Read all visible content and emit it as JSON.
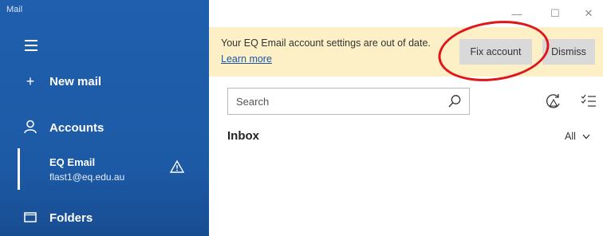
{
  "app": {
    "title": "Mail"
  },
  "sidebar": {
    "new_mail_label": "New mail",
    "accounts_label": "Accounts",
    "account": {
      "name": "EQ Email",
      "email": "flast1@eq.edu.au"
    },
    "folders_label": "Folders"
  },
  "window_controls": {
    "minimize": "—",
    "maximize": "☐",
    "close": "✕"
  },
  "banner": {
    "message": "Your EQ Email account settings are out of date.",
    "learn_more": "Learn more",
    "fix_account": "Fix account",
    "dismiss": "Dismiss"
  },
  "search": {
    "placeholder": "Search"
  },
  "inbox": {
    "title": "Inbox",
    "filter": "All"
  },
  "colors": {
    "sidebar": "#1f5fad",
    "banner": "#fdf0c6",
    "annotation": "#e0161b"
  },
  "icons": [
    "hamburger-icon",
    "plus-icon",
    "person-icon",
    "warning-icon",
    "folder-icon",
    "search-icon",
    "sync-icon",
    "filter-icon",
    "chevron-down-icon"
  ]
}
